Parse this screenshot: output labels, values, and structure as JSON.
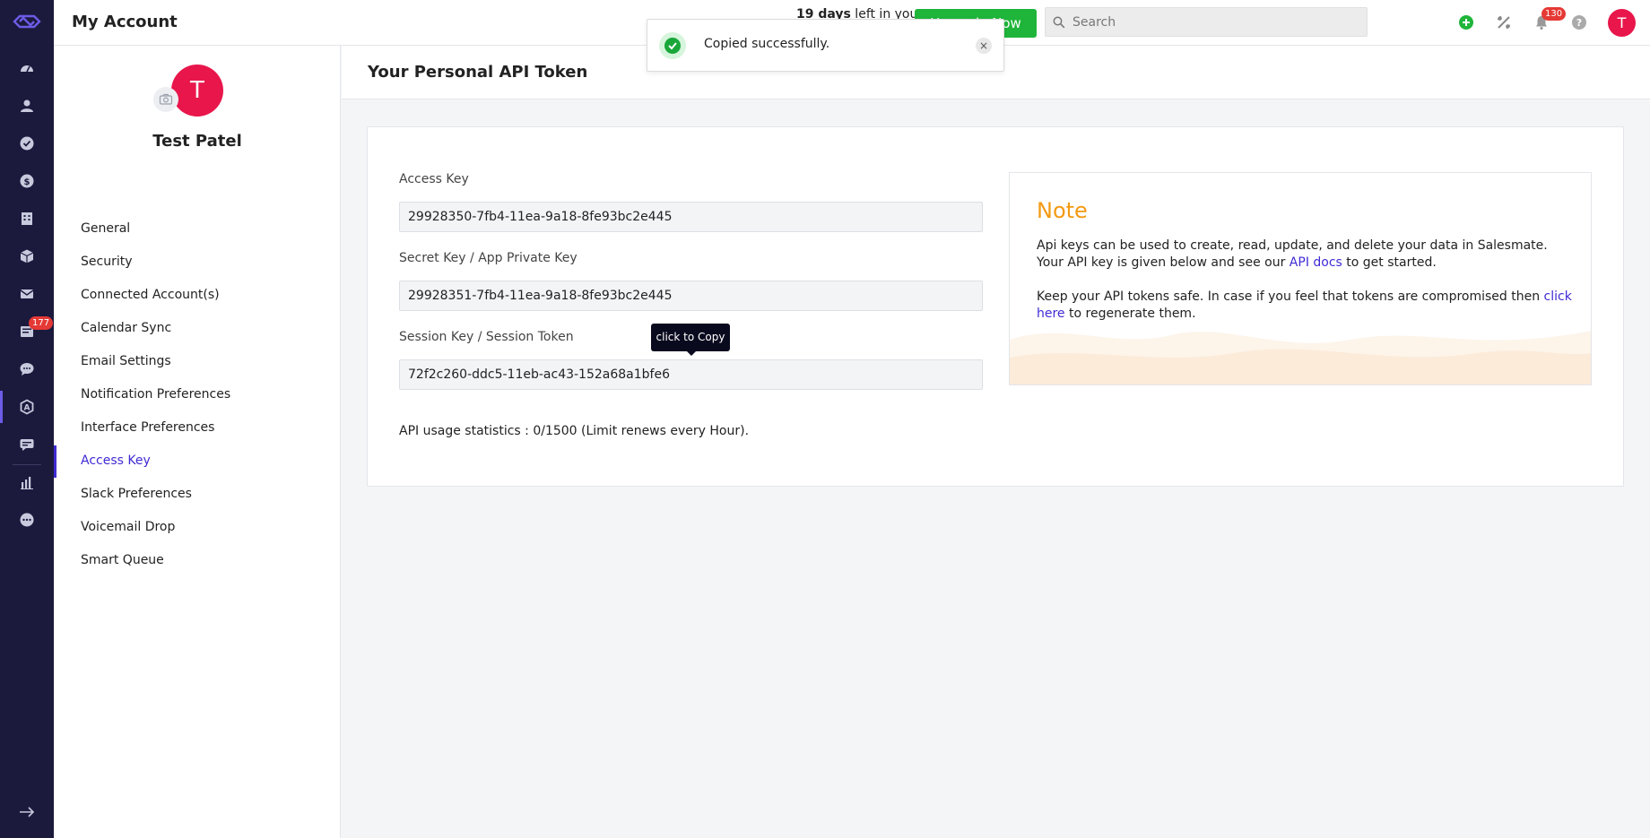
{
  "app": {
    "title": "My Account"
  },
  "topbar": {
    "trial_days": "19 days",
    "trial_suffix": " left in your",
    "upgrade_label": "Upgrade Now",
    "search_placeholder": "Search",
    "notification_count": "130",
    "user_initial": "T"
  },
  "toast": {
    "message": "Copied successfully.",
    "close": "×"
  },
  "rail": {
    "inbox_badge": "177",
    "icons": [
      "dashboard-icon",
      "contacts-icon",
      "tasks-icon",
      "deals-icon",
      "companies-icon",
      "products-icon",
      "email-icon",
      "inbox-icon",
      "chat-icon",
      "automation-icon",
      "messages-icon",
      "reports-icon",
      "more-icon",
      "expand-icon"
    ]
  },
  "profile": {
    "initial": "T",
    "name": "Test Patel"
  },
  "sidebar": {
    "items": [
      {
        "label": "General"
      },
      {
        "label": "Security"
      },
      {
        "label": "Connected Account(s)"
      },
      {
        "label": "Calendar Sync"
      },
      {
        "label": "Email Settings"
      },
      {
        "label": "Notification Preferences"
      },
      {
        "label": "Interface Preferences"
      },
      {
        "label": "Access Key"
      },
      {
        "label": "Slack Preferences"
      },
      {
        "label": "Voicemail Drop"
      },
      {
        "label": "Smart Queue"
      }
    ],
    "active_item": "Access Key"
  },
  "main": {
    "heading": "Your Personal API Token",
    "fields": [
      {
        "label": "Access Key",
        "value": "29928350-7fb4-11ea-9a18-8fe93bc2e445"
      },
      {
        "label": "Secret Key / App Private Key",
        "value": "29928351-7fb4-11ea-9a18-8fe93bc2e445"
      },
      {
        "label": "Session Key / Session Token",
        "value": "72f2c260-ddc5-11eb-ac43-152a68a1bfe6"
      }
    ],
    "tooltip": "click to Copy",
    "usage": "API usage statistics : 0/1500 (Limit renews every Hour).",
    "note": {
      "title": "Note",
      "p1_before": "Api keys can be used to create, read, update, and delete your data in Salesmate. Your API key is given below and see our ",
      "p1_link": "API docs",
      "p1_after": " to get started.",
      "p2_before": "Keep your API tokens safe. In case if you feel that tokens are compromised then ",
      "p2_link": "click here",
      "p2_after": " to regenerate them."
    }
  },
  "colors": {
    "rail_bg": "#1b1a3d",
    "accent": "#3f2bd4",
    "upgrade": "#1fb53a",
    "avatar": "#e8164b",
    "note_title": "#f39a13",
    "badge": "#e53935"
  }
}
